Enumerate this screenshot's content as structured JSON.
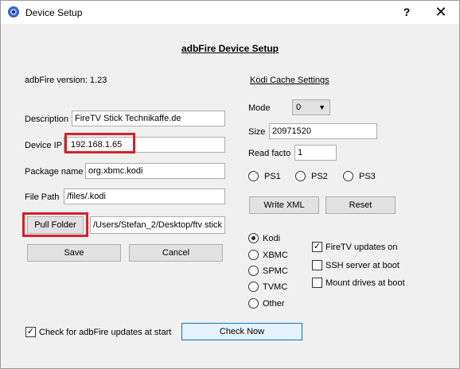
{
  "window": {
    "title": "Device Setup",
    "help": "?",
    "close": "✕"
  },
  "heading": "adbFire Device Setup",
  "version_label": "adbFire version: 1.23",
  "fields": {
    "description": {
      "label": "Description",
      "value": "FireTV Stick Technikaffe.de"
    },
    "device_ip": {
      "label": "Device IP",
      "value": "192.168.1.65"
    },
    "package_name": {
      "label": "Package name",
      "value": "org.xbmc.kodi"
    },
    "file_path": {
      "label": "File Path",
      "value": "/files/.kodi"
    }
  },
  "pull_folder": {
    "label": "Pull Folder",
    "value": "/Users/Stefan_2/Desktop/ftv stick"
  },
  "buttons": {
    "save": "Save",
    "cancel": "Cancel",
    "write_xml": "Write XML",
    "reset": "Reset",
    "check_now": "Check Now"
  },
  "kodi_cache": {
    "title": "Kodi Cache Settings",
    "mode_label": "Mode",
    "mode_value": "0",
    "size_label": "Size",
    "size_value": "20971520",
    "read_label": "Read facto",
    "read_value": "1",
    "ps": [
      "PS1",
      "PS2",
      "PS3"
    ]
  },
  "media_center": {
    "options": [
      "Kodi",
      "XBMC",
      "SPMC",
      "TVMC",
      "Other"
    ],
    "selected": "Kodi"
  },
  "options": {
    "firetv_updates": {
      "label": "FireTV updates on",
      "checked": true
    },
    "ssh_server": {
      "label": "SSH server at boot",
      "checked": false
    },
    "mount_drives": {
      "label": "Mount drives at boot",
      "checked": false
    }
  },
  "check_updates": {
    "label": "Check for adbFire updates at start",
    "checked": true
  },
  "colors": {
    "highlight": "#d6202a",
    "focus": "#0078d7"
  }
}
